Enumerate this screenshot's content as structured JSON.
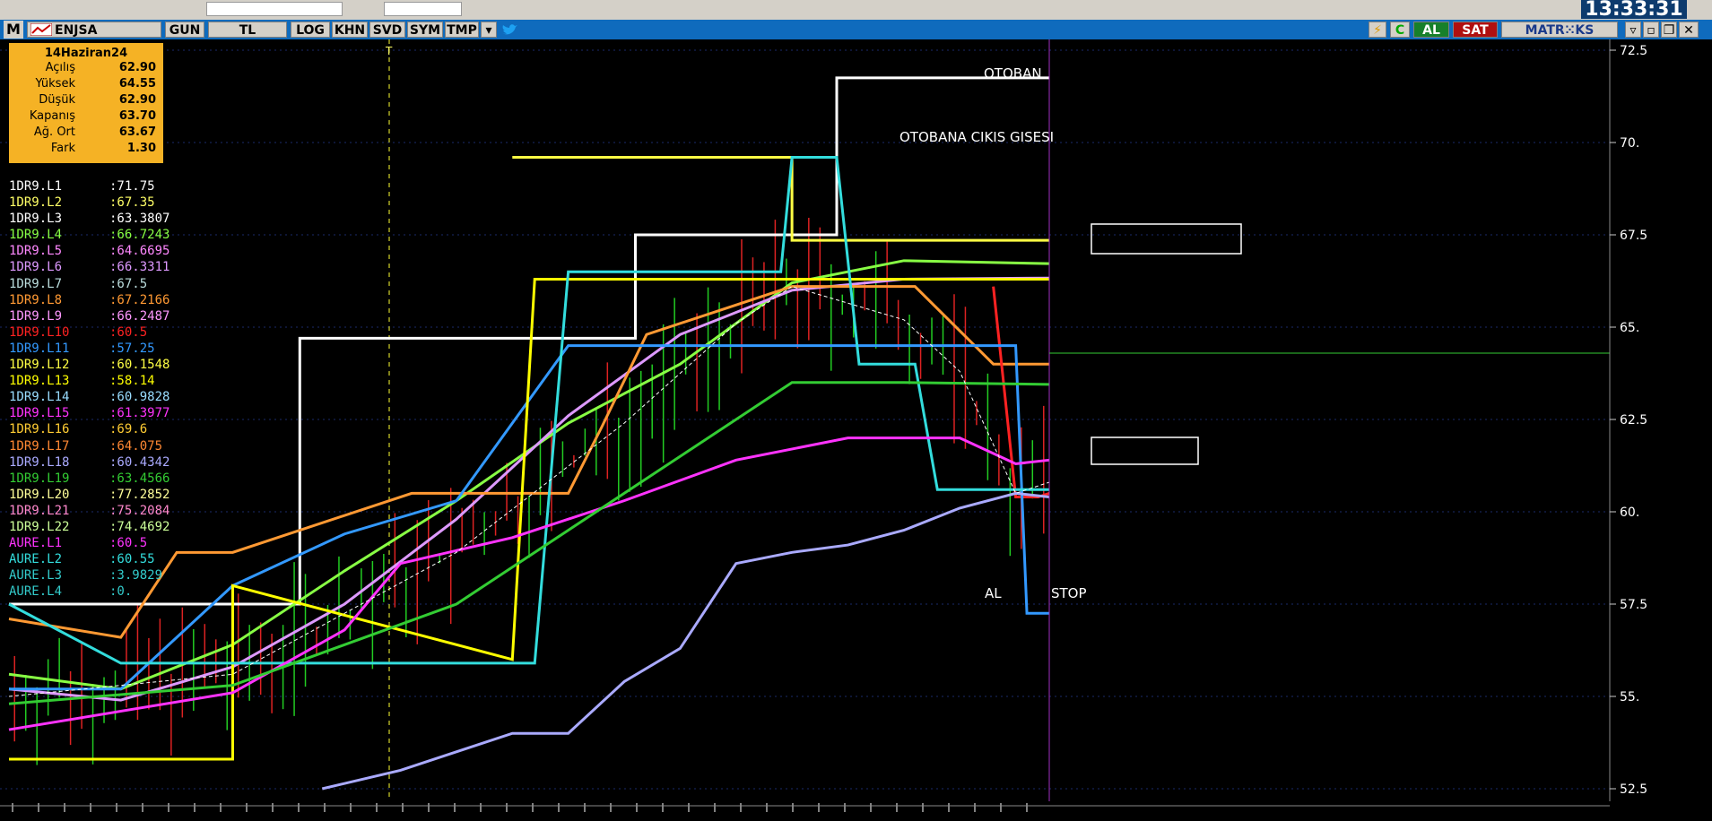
{
  "clock": "13:33:31",
  "toolbar": {
    "logo": "M",
    "symbol": "ENJSA",
    "buttons": [
      "GUN",
      "TL",
      "LOG",
      "KHN",
      "SVD",
      "SYM",
      "TMP"
    ],
    "al": "AL",
    "sat": "SAT",
    "brand": "MATR⁙KS",
    "c_label": "C"
  },
  "ohlc": {
    "date": "14Haziran24",
    "rows": [
      {
        "k": "Açılış",
        "v": "62.90"
      },
      {
        "k": "Yüksek",
        "v": "64.55"
      },
      {
        "k": "Düşük",
        "v": "62.90"
      },
      {
        "k": "Kapanış",
        "v": "63.70"
      },
      {
        "k": "Ağ. Ort",
        "v": "63.67"
      },
      {
        "k": "Fark",
        "v": "1.30"
      }
    ]
  },
  "legend": [
    {
      "n": "1DR9.L1",
      "v": ":71.75",
      "c": "#ffffff"
    },
    {
      "n": "1DR9.L2",
      "v": ":67.35",
      "c": "#ffff66"
    },
    {
      "n": "1DR9.L3",
      "v": ":63.3807",
      "c": "#ffffff"
    },
    {
      "n": "1DR9.L4",
      "v": ":66.7243",
      "c": "#88ff44"
    },
    {
      "n": "1DR9.L5",
      "v": ":64.6695",
      "c": "#ff88ff"
    },
    {
      "n": "1DR9.L6",
      "v": ":66.3311",
      "c": "#dd99ff"
    },
    {
      "n": "1DR9.L7",
      "v": ":67.5",
      "c": "#bbdddd"
    },
    {
      "n": "1DR9.L8",
      "v": ":67.2166",
      "c": "#ff9933"
    },
    {
      "n": "1DR9.L9",
      "v": ":66.2487",
      "c": "#ff99ff"
    },
    {
      "n": "1DR9.L10",
      "v": ":60.5",
      "c": "#ff2222"
    },
    {
      "n": "1DR9.L11",
      "v": ":57.25",
      "c": "#3399ff"
    },
    {
      "n": "1DR9.L12",
      "v": ":60.1548",
      "c": "#ffff44"
    },
    {
      "n": "1DR9.L13",
      "v": ":58.14",
      "c": "#ffff00"
    },
    {
      "n": "1DR9.L14",
      "v": ":60.9828",
      "c": "#99ddff"
    },
    {
      "n": "1DR9.L15",
      "v": ":61.3977",
      "c": "#ff33ff"
    },
    {
      "n": "1DR9.L16",
      "v": ":69.6",
      "c": "#ffcc33"
    },
    {
      "n": "1DR9.L17",
      "v": ":64.075",
      "c": "#ff8833"
    },
    {
      "n": "1DR9.L18",
      "v": ":60.4342",
      "c": "#aaaaff"
    },
    {
      "n": "1DR9.L19",
      "v": ":63.4566",
      "c": "#33cc33"
    },
    {
      "n": "1DR9.L20",
      "v": ":77.2852",
      "c": "#ffff99"
    },
    {
      "n": "1DR9.L21",
      "v": ":75.2084",
      "c": "#ff88cc"
    },
    {
      "n": "1DR9.L22",
      "v": ":74.4692",
      "c": "#ccff99"
    },
    {
      "n": "AURE.L1",
      "v": ":60.5",
      "c": "#ff33ff"
    },
    {
      "n": "AURE.L2",
      "v": ":60.55",
      "c": "#33dddd"
    },
    {
      "n": "AURE.L3",
      "v": ":3.9829",
      "c": "#33cccc"
    },
    {
      "n": "AURE.L4",
      "v": ":0.",
      "c": "#33cccc"
    }
  ],
  "annotations": {
    "otoban": "OTOBAN",
    "gise": "OTOBANA CIKIS GISESI",
    "al": "AL",
    "stop": "STOP",
    "t_marker": "T"
  },
  "chart_data": {
    "type": "line",
    "ylim": [
      52.5,
      72.5
    ],
    "y_ticks": [
      "72.5",
      "70.",
      "67.5",
      "65.",
      "62.5",
      "60.",
      "57.5",
      "55.",
      "52.5"
    ],
    "series": [
      {
        "name": "1DR9.L1",
        "color": "#ffffff",
        "x": [
          0,
          26,
          26,
          32,
          32,
          56,
          56,
          74,
          74,
          93
        ],
        "y": [
          57.5,
          57.5,
          64.7,
          64.7,
          64.7,
          64.7,
          67.5,
          67.5,
          71.75,
          71.75
        ]
      },
      {
        "name": "1DR9.L2",
        "color": "#ffff44",
        "x": [
          45,
          70,
          70,
          93
        ],
        "y": [
          69.6,
          69.6,
          67.35,
          67.35
        ]
      },
      {
        "name": "1DR9.L4",
        "color": "#88ff44",
        "x": [
          0,
          10,
          20,
          30,
          40,
          50,
          60,
          70,
          80,
          93
        ],
        "y": [
          55.6,
          55.2,
          56.4,
          58.4,
          60.3,
          62.4,
          64.0,
          66.2,
          66.8,
          66.72
        ]
      },
      {
        "name": "1DR9.L6",
        "color": "#dd99ff",
        "x": [
          0,
          10,
          20,
          30,
          40,
          50,
          60,
          70,
          80,
          93
        ],
        "y": [
          55.2,
          54.9,
          55.8,
          57.5,
          59.8,
          62.6,
          64.8,
          66.0,
          66.3,
          66.33
        ]
      },
      {
        "name": "1DR9.L8",
        "color": "#ff9933",
        "x": [
          0,
          10,
          15,
          20,
          36,
          50,
          53,
          57,
          70,
          81,
          88,
          93
        ],
        "y": [
          57.1,
          56.6,
          58.9,
          58.9,
          60.5,
          60.5,
          62.3,
          64.8,
          66.1,
          66.1,
          64.0,
          64.0
        ]
      },
      {
        "name": "1DR9.L10",
        "color": "#ff2222",
        "x": [
          88,
          90,
          92,
          93
        ],
        "y": [
          66.1,
          60.4,
          60.4,
          60.5
        ]
      },
      {
        "name": "1DR9.L11",
        "color": "#3399ff",
        "x": [
          0,
          10,
          20,
          30,
          40,
          50,
          60,
          70,
          80,
          90,
          91,
          93
        ],
        "y": [
          55.2,
          55.2,
          58.0,
          59.4,
          60.3,
          64.5,
          64.5,
          64.5,
          64.5,
          64.5,
          57.25,
          57.25
        ]
      },
      {
        "name": "1DR9.L13",
        "color": "#ffff00",
        "x": [
          0,
          20,
          20,
          45,
          45,
          47,
          47,
          93
        ],
        "y": [
          53.3,
          53.3,
          58.0,
          56.0,
          56.0,
          66.3,
          66.3,
          66.3
        ]
      },
      {
        "name": "1DR9.L14",
        "color": "#33dddd",
        "x": [
          0,
          10,
          20,
          35,
          47,
          50,
          66,
          69,
          70,
          74,
          76,
          81,
          83,
          93
        ],
        "y": [
          57.5,
          55.9,
          55.9,
          55.9,
          55.9,
          66.5,
          66.5,
          66.5,
          69.6,
          69.6,
          64.0,
          64.0,
          60.6,
          60.6
        ]
      },
      {
        "name": "1DR9.L15",
        "color": "#ff33ff",
        "x": [
          0,
          20,
          30,
          35,
          45,
          55,
          65,
          75,
          85,
          90,
          93
        ],
        "y": [
          54.1,
          55.1,
          56.8,
          58.6,
          59.3,
          60.3,
          61.4,
          62.0,
          62.0,
          61.3,
          61.4
        ]
      },
      {
        "name": "1DR9.L18",
        "color": "#aaaaff",
        "x": [
          28,
          35,
          40,
          45,
          50,
          55,
          60,
          65,
          70,
          75,
          80,
          85,
          90,
          93
        ],
        "y": [
          52.5,
          53.0,
          53.5,
          54.0,
          54.0,
          55.4,
          56.3,
          58.6,
          58.9,
          59.1,
          59.5,
          60.1,
          60.5,
          60.4
        ]
      },
      {
        "name": "1DR9.L19",
        "color": "#33cc33",
        "x": [
          0,
          20,
          40,
          55,
          65,
          70,
          80,
          93
        ],
        "y": [
          54.8,
          55.3,
          57.5,
          60.5,
          62.5,
          63.5,
          63.5,
          63.45
        ]
      },
      {
        "name": "1DR9.L3",
        "color": "#ffffff",
        "x": [
          0,
          20,
          40,
          55,
          65,
          70,
          80,
          85,
          90,
          93
        ],
        "y": [
          55.0,
          55.6,
          58.9,
          62.4,
          65.1,
          66.1,
          65.2,
          63.8,
          60.5,
          60.8
        ]
      }
    ]
  }
}
